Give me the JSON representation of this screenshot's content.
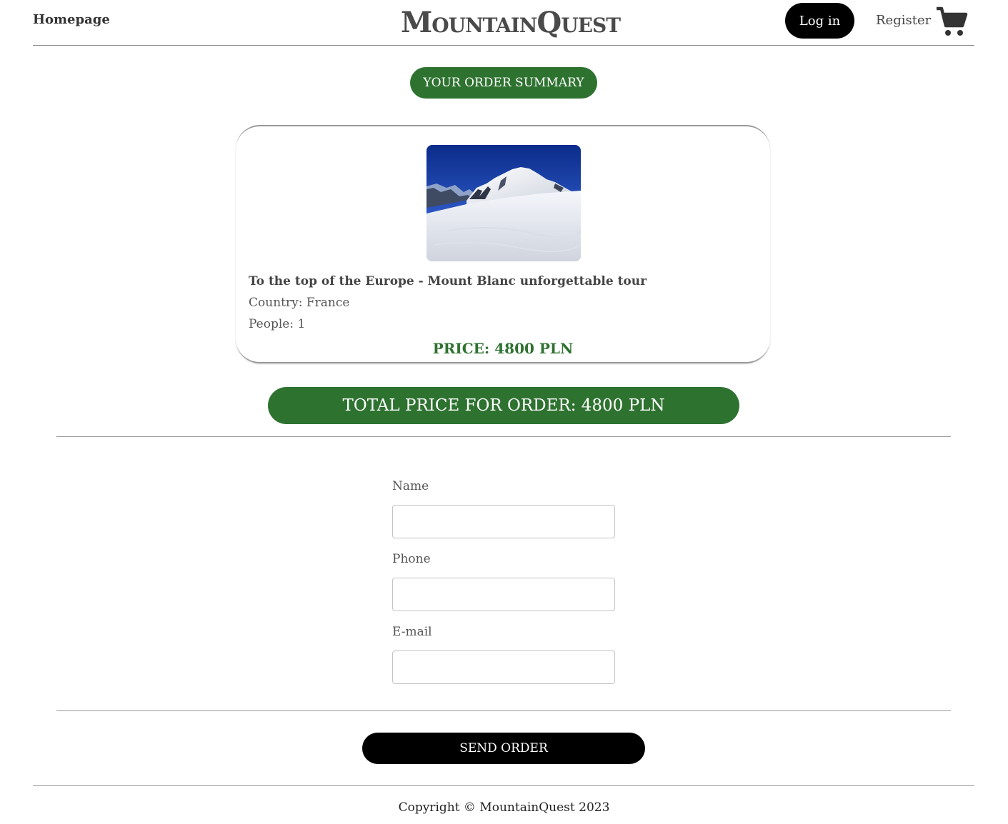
{
  "header": {
    "home_link": "Homepage",
    "brand": "MountainQuest",
    "login_label": "Log in",
    "register_label": "Register",
    "cart_icon": "shopping-cart-icon"
  },
  "summary": {
    "heading": "YOUR ORDER SUMMARY"
  },
  "order_items": [
    {
      "image": "mountain-snow-photo",
      "title": "To the top of the Europe - Mount Blanc unforgettable tour",
      "country": "Country: France",
      "people": "People: 1",
      "price": "PRICE: 4800 PLN"
    }
  ],
  "total": {
    "label": "TOTAL PRICE FOR ORDER: 4800 PLN"
  },
  "form": {
    "name_label": "Name",
    "name_value": "",
    "phone_label": "Phone",
    "phone_value": "",
    "email_label": "E-mail",
    "email_value": "",
    "submit_label": "SEND ORDER"
  },
  "footer": {
    "copyright": "Copyright © MountainQuest 2023"
  },
  "colors": {
    "accent_green": "#2e7230",
    "button_black": "#000000",
    "text_dark": "#444444"
  }
}
